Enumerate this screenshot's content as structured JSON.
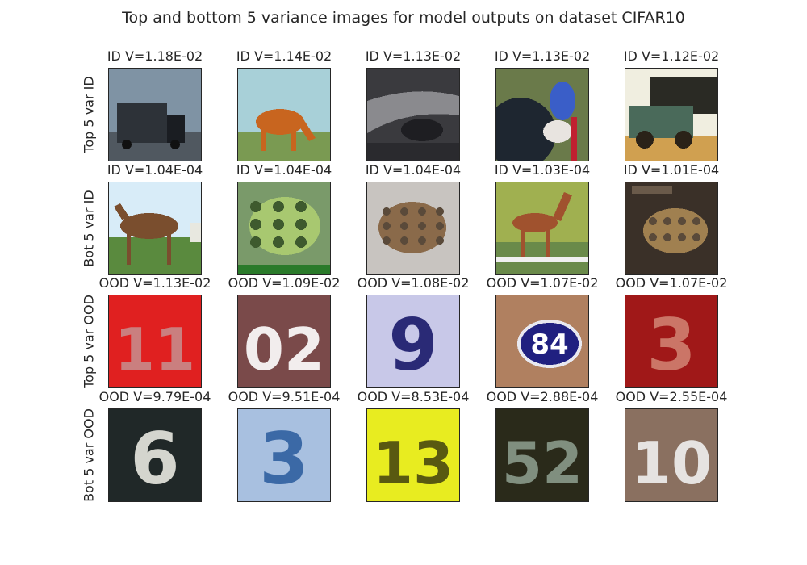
{
  "title": "Top and bottom 5 variance images for model outputs on dataset CIFAR10",
  "chart_data": {
    "type": "image-grid",
    "title": "Top and bottom 5 variance images for model outputs on dataset CIFAR10",
    "rows": [
      {
        "label": "Top 5 var ID",
        "cells": [
          {
            "caption": "ID V=1.18E-02",
            "variance": 0.0118,
            "scene": "truck",
            "colors": [
              "#7f93a4",
              "#2d3238",
              "#505860"
            ]
          },
          {
            "caption": "ID V=1.14E-02",
            "variance": 0.0114,
            "scene": "horse",
            "colors": [
              "#a8d0d8",
              "#c8651f",
              "#7a9a52"
            ]
          },
          {
            "caption": "ID V=1.13E-02",
            "variance": 0.0113,
            "scene": "car-road",
            "colors": [
              "#3a3a3e",
              "#8a8a8e",
              "#1e1e22"
            ]
          },
          {
            "caption": "ID V=1.13E-02",
            "variance": 0.0113,
            "scene": "bird",
            "colors": [
              "#6a7a4a",
              "#1e2630",
              "#3a5ec8"
            ]
          },
          {
            "caption": "ID V=1.12E-02",
            "variance": 0.0112,
            "scene": "old-truck",
            "colors": [
              "#f0eee0",
              "#4a6a5a",
              "#d0a050"
            ]
          }
        ]
      },
      {
        "label": "Bot 5 var ID",
        "cells": [
          {
            "caption": "ID V=1.04E-04",
            "variance": 0.000104,
            "scene": "horse-field",
            "colors": [
              "#d8ecf8",
              "#7a4e2e",
              "#5a8a3e"
            ]
          },
          {
            "caption": "ID V=1.04E-04",
            "variance": 0.000104,
            "scene": "frog-green",
            "colors": [
              "#7a9a6a",
              "#a8c870",
              "#3e5a2e"
            ]
          },
          {
            "caption": "ID V=1.04E-04",
            "variance": 0.000104,
            "scene": "frog-brown",
            "colors": [
              "#c8c4c0",
              "#8a6a4a",
              "#5a4a3a"
            ]
          },
          {
            "caption": "ID V=1.03E-04",
            "variance": 0.000103,
            "scene": "horse-trees",
            "colors": [
              "#a0b050",
              "#a0522e",
              "#6a8a4a"
            ]
          },
          {
            "caption": "ID V=1.01E-04",
            "variance": 0.000101,
            "scene": "frog-dark",
            "colors": [
              "#3a3028",
              "#a08050",
              "#5a4a3a"
            ]
          }
        ]
      },
      {
        "label": "Top 5 var OOD",
        "cells": [
          {
            "caption": "OOD V=1.13E-02",
            "variance": 0.0113,
            "scene": "digits",
            "digits": "11",
            "colors": [
              "#e02020",
              "#c88a8a",
              "#b01818"
            ]
          },
          {
            "caption": "OOD V=1.09E-02",
            "variance": 0.0109,
            "scene": "digits",
            "digits": "02",
            "colors": [
              "#7a4a4a",
              "#ffffff",
              "#6a3a3a"
            ]
          },
          {
            "caption": "OOD V=1.08E-02",
            "variance": 0.0108,
            "scene": "digits",
            "digits": "9",
            "colors": [
              "#c8c8e8",
              "#1a1a6a",
              "#a0a0d0"
            ]
          },
          {
            "caption": "OOD V=1.07E-02",
            "variance": 0.0107,
            "scene": "badge",
            "digits": "84",
            "colors": [
              "#b08060",
              "#ffffff",
              "#202080"
            ]
          },
          {
            "caption": "OOD V=1.07E-02",
            "variance": 0.0107,
            "scene": "digits",
            "digits": "3",
            "colors": [
              "#a01818",
              "#d08070",
              "#e0e0e0"
            ]
          }
        ]
      },
      {
        "label": "Bot 5 var OOD",
        "cells": [
          {
            "caption": "OOD V=9.79E-04",
            "variance": 0.000979,
            "scene": "digits",
            "digits": "6",
            "colors": [
              "#202828",
              "#e8e8e0",
              "#3a4a4a"
            ]
          },
          {
            "caption": "OOD V=9.51E-04",
            "variance": 0.000951,
            "scene": "digits",
            "digits": "3",
            "colors": [
              "#a8c0e0",
              "#3060a0",
              "#c8d8ec"
            ]
          },
          {
            "caption": "OOD V=8.53E-04",
            "variance": 0.000853,
            "scene": "digits",
            "digits": "13",
            "colors": [
              "#e8ec20",
              "#4a4a10",
              "#d8dc18"
            ]
          },
          {
            "caption": "OOD V=2.88E-04",
            "variance": 0.000288,
            "scene": "digits",
            "digits": "52",
            "colors": [
              "#2a2a1a",
              "#8a9a8a",
              "#3a3a28"
            ]
          },
          {
            "caption": "OOD V=2.55E-04",
            "variance": 0.000255,
            "scene": "digits",
            "digits": "10",
            "colors": [
              "#8a7060",
              "#f0f0f0",
              "#1a2a4a"
            ]
          }
        ]
      }
    ]
  }
}
